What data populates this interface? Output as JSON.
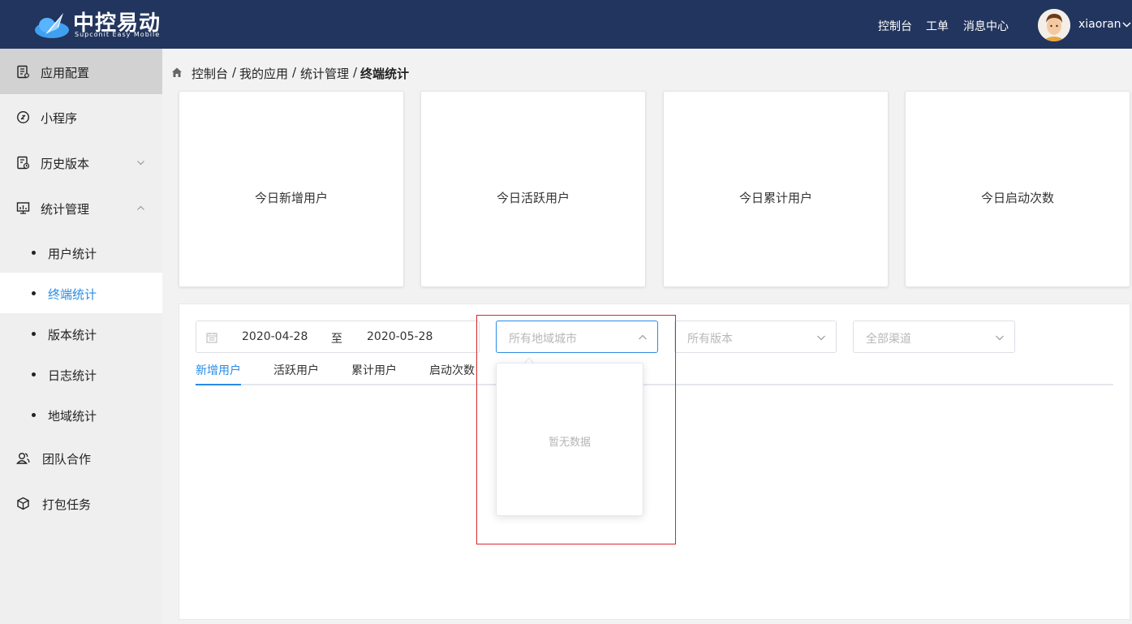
{
  "header": {
    "brand_title": "中控易动",
    "brand_subtitle": "Supconit Easy Mobile",
    "nav": [
      "控制台",
      "工单",
      "消息中心"
    ],
    "username": "xiaoran",
    "bg_color": "#22355e"
  },
  "sidebar": {
    "items": [
      {
        "label": "应用配置",
        "icon": "app-config-icon"
      },
      {
        "label": "小程序",
        "icon": "link-icon"
      },
      {
        "label": "历史版本",
        "icon": "history-icon"
      },
      {
        "label": "统计管理",
        "icon": "monitor-chart-icon"
      }
    ],
    "sub_items": [
      "用户统计",
      "终端统计",
      "版本统计",
      "日志统计",
      "地域统计"
    ],
    "bottom_items": [
      {
        "label": "团队合作",
        "icon": "team-icon"
      },
      {
        "label": "打包任务",
        "icon": "package-icon"
      }
    ],
    "accent_color": "#2a8ce6"
  },
  "breadcrumb": [
    "控制台",
    "我的应用",
    "统计管理",
    "终端统计"
  ],
  "cards": [
    "今日新增用户",
    "今日活跃用户",
    "今日累计用户",
    "今日启动次数"
  ],
  "filters": {
    "date_start": "2020-04-28",
    "date_sep": "至",
    "date_end": "2020-05-28",
    "region_placeholder": "所有地域城市",
    "version_placeholder": "所有版本",
    "channel_placeholder": "全部渠道"
  },
  "tabs": [
    "新增用户",
    "活跃用户",
    "累计用户",
    "启动次数"
  ],
  "dropdown": {
    "empty_text": "暂无数据"
  }
}
